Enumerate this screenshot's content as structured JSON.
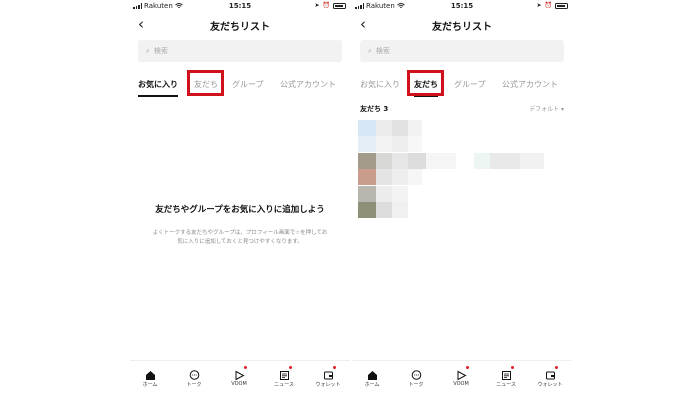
{
  "status_bar": {
    "carrier": "Rakuten",
    "time": "15:15"
  },
  "header": {
    "title": "友だちリスト"
  },
  "search": {
    "placeholder": "検索"
  },
  "tabs": [
    {
      "label": "お気に入り"
    },
    {
      "label": "友だち"
    },
    {
      "label": "グループ"
    },
    {
      "label": "公式アカウント"
    }
  ],
  "left_screen": {
    "active_tab": "お気に入り",
    "highlighted_tab": "友だち"
  },
  "right_screen": {
    "active_tab": "友だち",
    "highlighted_tab": "友だち"
  },
  "empty_state": {
    "title": "友だちやグループをお気に入りに追加しよう",
    "description": "よくトークする友だちやグループは、プロフィール画面で☆を押してお気に入りに追加しておくと見つけやすくなります。"
  },
  "friends_section": {
    "label": "友だち 3",
    "sort": "デフォルト ▾"
  },
  "bottom_nav": [
    {
      "label": "ホーム",
      "icon": "home-icon",
      "badge": false
    },
    {
      "label": "トーク",
      "icon": "chat-icon",
      "badge": false
    },
    {
      "label": "VOOM",
      "icon": "voom-icon",
      "badge": true
    },
    {
      "label": "ニュース",
      "icon": "news-icon",
      "badge": true
    },
    {
      "label": "ウォレット",
      "icon": "wallet-icon",
      "badge": true
    }
  ],
  "colors": {
    "highlight": "#d0101a",
    "badge": "#e3202a",
    "search_bg": "#f2f2f2"
  }
}
